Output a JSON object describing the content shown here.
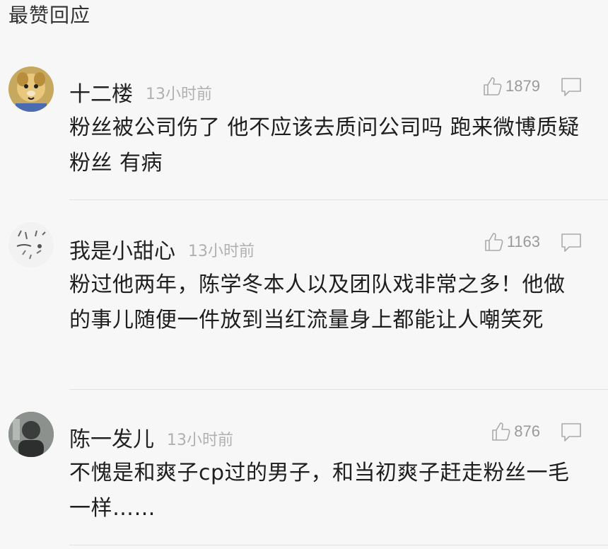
{
  "header": {
    "title": "最赞回应"
  },
  "comments": [
    {
      "username": "十二楼",
      "time": "13小时前",
      "likes": "1879",
      "text": "粉丝被公司伤了 他不应该去质问公司吗 跑来微博质疑粉丝 有病",
      "avatar_icon": "dog-avatar-icon"
    },
    {
      "username": "我是小甜心",
      "time": "13小时前",
      "likes": "1163",
      "text": "粉过他两年，陈学冬本人以及团队戏非常之多！他做的事儿随便一件放到当红流量身上都能让人嘲笑死",
      "avatar_icon": "sketch-avatar-icon"
    },
    {
      "username": "陈一发儿",
      "time": "13小时前",
      "likes": "876",
      "text": "不愧是和爽子cp过的男子，和当初爽子赶走粉丝一毛一样……",
      "avatar_icon": "person-avatar-icon"
    }
  ],
  "icons": {
    "like": "thumbs-up-icon",
    "reply": "comment-bubble-icon"
  },
  "colors": {
    "background": "#f7f7f7",
    "text": "#1e1e1e",
    "muted": "#b0b0b0",
    "divider": "#e2e2e2"
  }
}
